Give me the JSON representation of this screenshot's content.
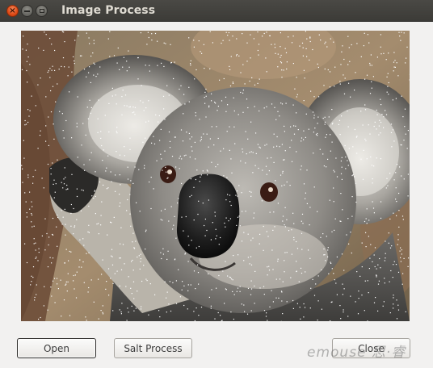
{
  "window": {
    "title": "Image Process"
  },
  "titlebar_icons": {
    "close": "close-icon",
    "minimize": "minimize-icon",
    "maximize": "maximize-icon"
  },
  "image": {
    "subject": "koala-with-salt-noise"
  },
  "buttons": {
    "open_label": "Open",
    "salt_label": "Salt Process",
    "close_label": "Close"
  },
  "watermark": {
    "text": "emouse 思·睿"
  }
}
